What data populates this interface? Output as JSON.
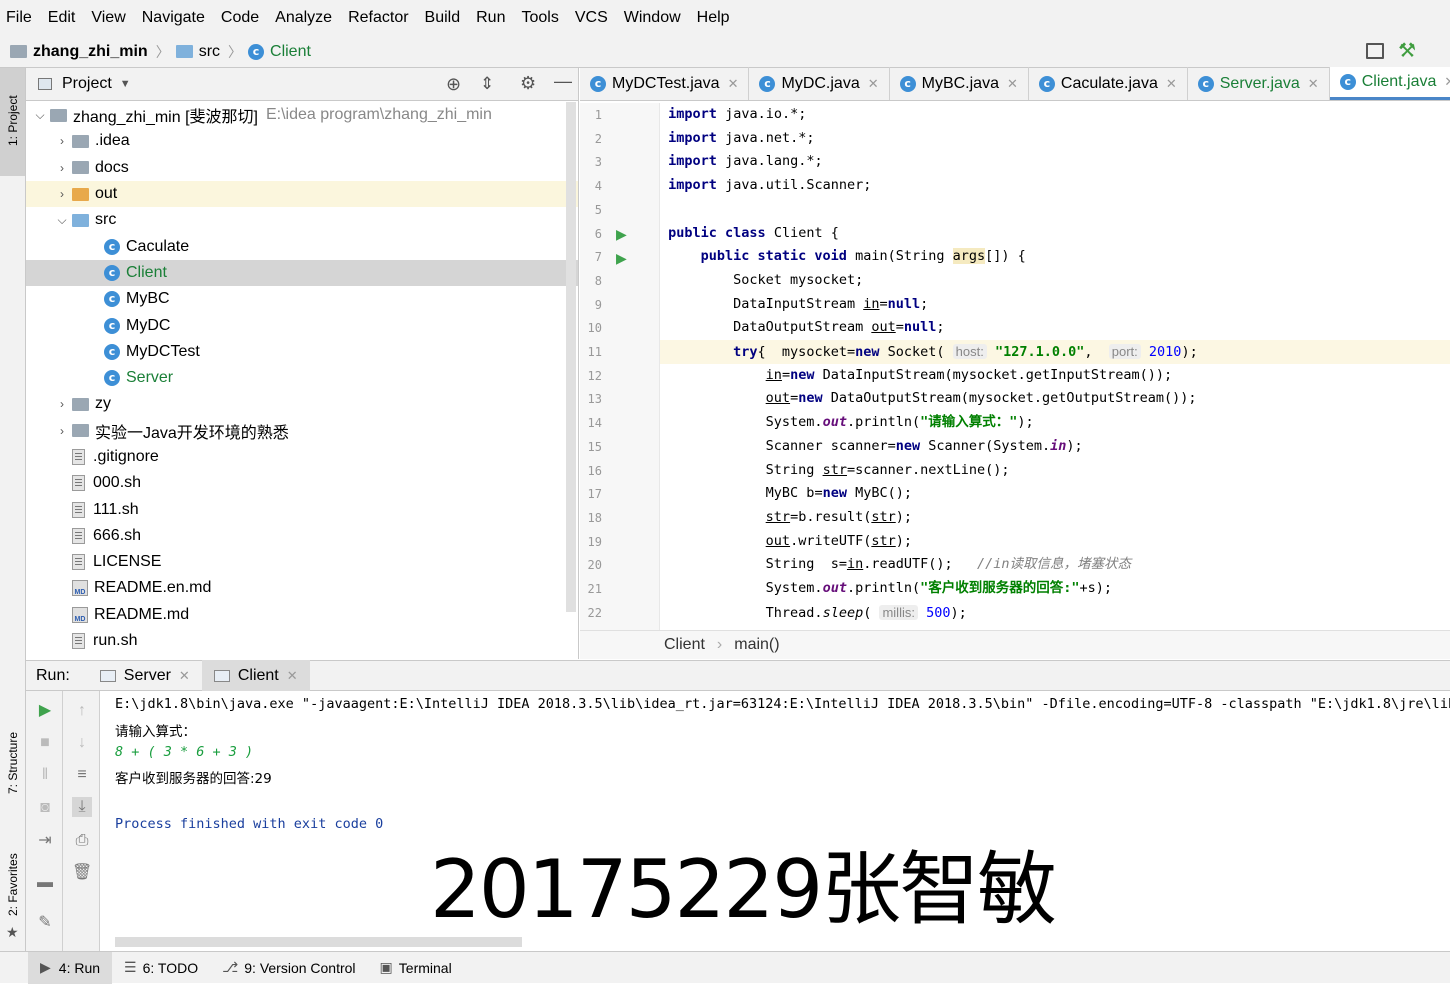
{
  "menu": [
    "File",
    "Edit",
    "View",
    "Navigate",
    "Code",
    "Analyze",
    "Refactor",
    "Build",
    "Run",
    "Tools",
    "VCS",
    "Window",
    "Help"
  ],
  "nav": {
    "project": "zhang_zhi_min",
    "src": "src",
    "file": "Client"
  },
  "left_tool": {
    "project": "1: Project",
    "structure": "7: Structure",
    "favorites": "2: Favorites"
  },
  "project_panel": {
    "title": "Project",
    "root_name": "zhang_zhi_min [斐波那切]",
    "root_path": "E:\\idea program\\zhang_zhi_min",
    "items": [
      {
        "label": ".idea",
        "type": "folder"
      },
      {
        "label": "docs",
        "type": "folder"
      },
      {
        "label": "out",
        "type": "folder-orange"
      },
      {
        "label": "src",
        "type": "folder-blue"
      },
      {
        "label": "Caculate",
        "type": "class-run"
      },
      {
        "label": "Client",
        "type": "class-run"
      },
      {
        "label": "MyBC",
        "type": "class"
      },
      {
        "label": "MyDC",
        "type": "class"
      },
      {
        "label": "MyDCTest",
        "type": "class-run"
      },
      {
        "label": "Server",
        "type": "class-run"
      },
      {
        "label": "zy",
        "type": "folder"
      },
      {
        "label": "实验一Java开发环境的熟悉",
        "type": "folder"
      },
      {
        "label": ".gitignore",
        "type": "file"
      },
      {
        "label": "000.sh",
        "type": "file"
      },
      {
        "label": "111.sh",
        "type": "file"
      },
      {
        "label": "666.sh",
        "type": "file"
      },
      {
        "label": "LICENSE",
        "type": "file"
      },
      {
        "label": "README.en.md",
        "type": "md"
      },
      {
        "label": "README.md",
        "type": "md"
      },
      {
        "label": "run.sh",
        "type": "file"
      }
    ]
  },
  "tabs": [
    "MyDCTest.java",
    "MyDC.java",
    "MyBC.java",
    "Caculate.java",
    "Server.java",
    "Client.java"
  ],
  "code_lines": [
    "1",
    "2",
    "3",
    "4",
    "5",
    "6",
    "7",
    "8",
    "9",
    "10",
    "11",
    "12",
    "13",
    "14",
    "15",
    "16",
    "17",
    "18",
    "19",
    "20",
    "21",
    "22"
  ],
  "code": {
    "l1": "java.io.*;",
    "l2": "java.net.*;",
    "l3": "java.lang.*;",
    "l4": "java.util.Scanner;",
    "import": "import",
    "l6_class": "Client {",
    "l7_rest": "main(String ",
    "l7_args": "args",
    "l7_end": "[]) {",
    "l8": "Socket mysocket;",
    "l9a": "DataInputStream ",
    "l9b": "in",
    "l10a": "DataOutputStream ",
    "l10b": "out",
    "host_hint": "host:",
    "host_val": "\"127.1.0.0\"",
    "port_hint": "port:",
    "port_val": "2010",
    "l12": "DataInputStream(mysocket.getInputStream());",
    "l13": "DataOutputStream(mysocket.getOutputStream());",
    "l14_str": "\"请输入算式：\"",
    "l15": "Scanner scanner=",
    "l16": "String ",
    "l16b": "=scanner.nextLine();",
    "l17": "MyBC b=",
    "l18": "=b.result(",
    "l19": ".writeUTF(",
    "l20a": "String  s=",
    "l20b": ".readUTF();",
    "l20c": "//in读取信息，堵塞状态",
    "l21_str": "\"客户收到服务器的回答:\"",
    "l22_hint": "millis:",
    "l22_val": "500"
  },
  "editor_breadcrumb": {
    "a": "Client",
    "b": "main()"
  },
  "run": {
    "label": "Run:",
    "tabs": [
      "Server",
      "Client"
    ],
    "console": [
      "E:\\jdk1.8\\bin\\java.exe \"-javaagent:E:\\IntelliJ IDEA 2018.3.5\\lib\\idea_rt.jar=63124:E:\\IntelliJ IDEA 2018.3.5\\bin\" -Dfile.encoding=UTF-8 -classpath \"E:\\jdk1.8\\jre\\lib\\c",
      "请输入算式：",
      "8 + ( 3 * 6 + 3 )",
      "客户收到服务器的回答:29",
      "Process finished with exit code 0"
    ]
  },
  "watermark": "20175229张智敏",
  "status_tabs": [
    "4: Run",
    "6: TODO",
    "9: Version Control",
    "Terminal"
  ]
}
